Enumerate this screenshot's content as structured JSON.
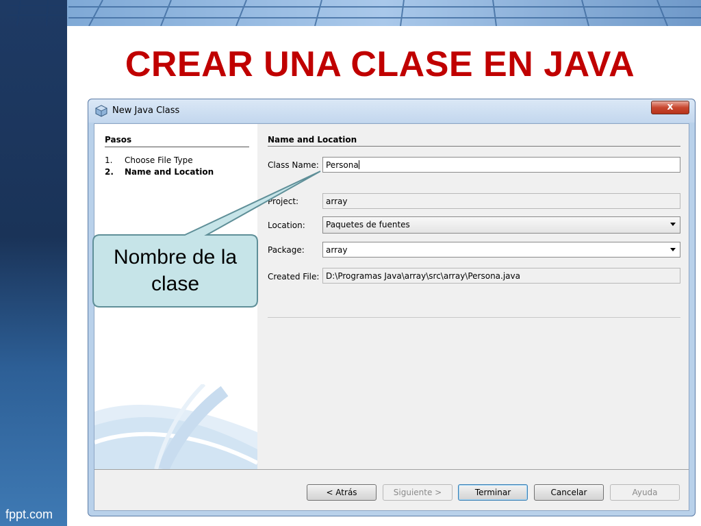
{
  "slide": {
    "title": "CREAR UNA CLASE EN JAVA",
    "footer_brand": "fppt.com",
    "title_color": "#c00000"
  },
  "dialog": {
    "title": "New Java Class",
    "close_label": "x",
    "steps": {
      "heading": "Pasos",
      "items": [
        {
          "num": "1.",
          "label": "Choose File Type",
          "current": false
        },
        {
          "num": "2.",
          "label": "Name and Location",
          "current": true
        }
      ]
    },
    "form": {
      "heading": "Name and Location",
      "class_name": {
        "label": "Class Name:",
        "value": "Persona"
      },
      "project": {
        "label": "Project:",
        "value": "array"
      },
      "location": {
        "label": "Location:",
        "value": "Paquetes de fuentes"
      },
      "package": {
        "label": "Package:",
        "value": "array"
      },
      "created_file": {
        "label": "Created File:",
        "value": "D:\\Programas Java\\array\\src\\array\\Persona.java"
      }
    },
    "buttons": {
      "back": "< Atrás",
      "next": "Siguiente >",
      "finish": "Terminar",
      "cancel": "Cancelar",
      "help": "Ayuda"
    }
  },
  "callout": {
    "line1": "Nombre de la",
    "line2": "clase",
    "fill_color": "#c6e4e8",
    "border_color": "#5f8f98"
  }
}
